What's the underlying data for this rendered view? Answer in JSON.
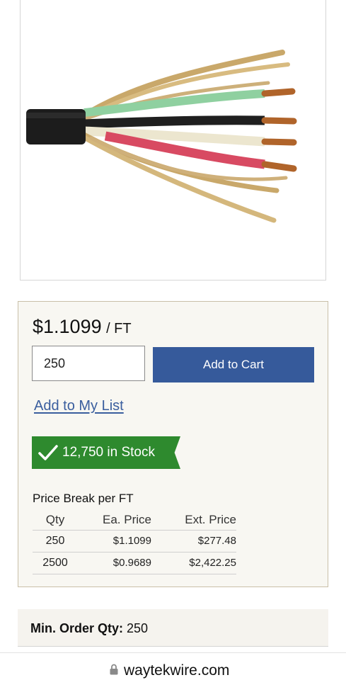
{
  "product_image": {
    "icon": "cable-image"
  },
  "pricing": {
    "amount": "$1.1099",
    "unit": "/ FT"
  },
  "cart": {
    "quantity_value": "250",
    "add_to_cart_label": "Add to Cart"
  },
  "list_link": "Add to My List",
  "stock": {
    "text": "12,750 in Stock",
    "color": "#2e8a2e"
  },
  "price_break": {
    "title": "Price Break per FT",
    "headers": {
      "qty": "Qty",
      "each": "Ea. Price",
      "ext": "Ext. Price"
    },
    "rows": [
      {
        "qty": "250",
        "each": "$1.1099",
        "ext": "$277.48"
      },
      {
        "qty": "2500",
        "each": "$0.9689",
        "ext": "$2,422.25"
      }
    ]
  },
  "min_order": {
    "label": "Min. Order Qty:",
    "value": "250"
  },
  "browser": {
    "url": "waytekwire.com"
  },
  "colors": {
    "accent": "#365a9b",
    "link": "#3a5e9e",
    "stock_green": "#2e8a2e"
  }
}
